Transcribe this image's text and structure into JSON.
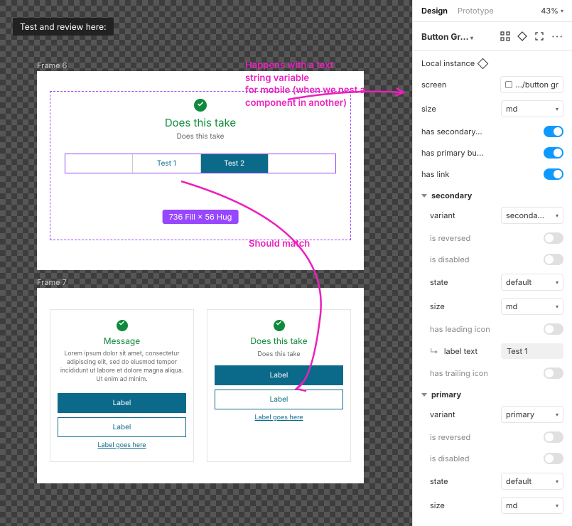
{
  "tooltip": "Test and review here:",
  "canvas": {
    "frame6": {
      "name": "Frame 6",
      "title": "Does this take",
      "subtitle": "Does this take",
      "buttons": [
        "",
        "Test 1",
        "Test 2",
        ""
      ],
      "sizeBadge": "736 Fill × 56 Hug"
    },
    "frame7": {
      "name": "Frame 7",
      "cardA": {
        "title": "Message",
        "desc": "Lorem ipsum dolor sit amet, consectetur adipiscing elit, sed do eiusmod tempor incididunt ut labore et dolore magna aliqua. Ut enim ad minim.",
        "btn1": "Label",
        "btn2": "Label",
        "link": "Label goes here"
      },
      "cardB": {
        "title": "Does this take",
        "sub": "Does this take",
        "btn1": "Label",
        "btn2": "Label",
        "link": "Label goes here"
      }
    },
    "annotations": {
      "a1": "Happens with a text\nstring variable\nfor mobile (when we nest a\ncomponent in another)",
      "a2": "Should match"
    }
  },
  "panel": {
    "tabs": {
      "design": "Design",
      "prototype": "Prototype"
    },
    "zoom": "43%",
    "componentName": "Button Gr...",
    "localInstance": "Local instance",
    "props": {
      "screen": {
        "label": "screen",
        "value": ".../button gr"
      },
      "size": {
        "label": "size",
        "value": "md"
      },
      "hasSecondary": {
        "label": "has secondary...",
        "value": true
      },
      "hasPrimary": {
        "label": "has primary bu...",
        "value": true
      },
      "hasLink": {
        "label": "has link",
        "value": true
      }
    },
    "secondary": {
      "title": "secondary",
      "variant": {
        "label": "variant",
        "value": "seconda..."
      },
      "isReversed": {
        "label": "is reversed",
        "value": false
      },
      "isDisabled": {
        "label": "is disabled",
        "value": false
      },
      "state": {
        "label": "state",
        "value": "default"
      },
      "size": {
        "label": "size",
        "value": "md"
      },
      "hasLeading": {
        "label": "has leading icon",
        "value": false
      },
      "labelText": {
        "label": "label text",
        "value": "Test 1"
      },
      "hasTrailing": {
        "label": "has trailing icon",
        "value": false
      }
    },
    "primary": {
      "title": "primary",
      "variant": {
        "label": "variant",
        "value": "primary"
      },
      "isReversed": {
        "label": "is reversed",
        "value": false
      },
      "isDisabled": {
        "label": "is disabled",
        "value": false
      },
      "state": {
        "label": "state",
        "value": "default"
      },
      "size": {
        "label": "size",
        "value": "md"
      }
    }
  }
}
